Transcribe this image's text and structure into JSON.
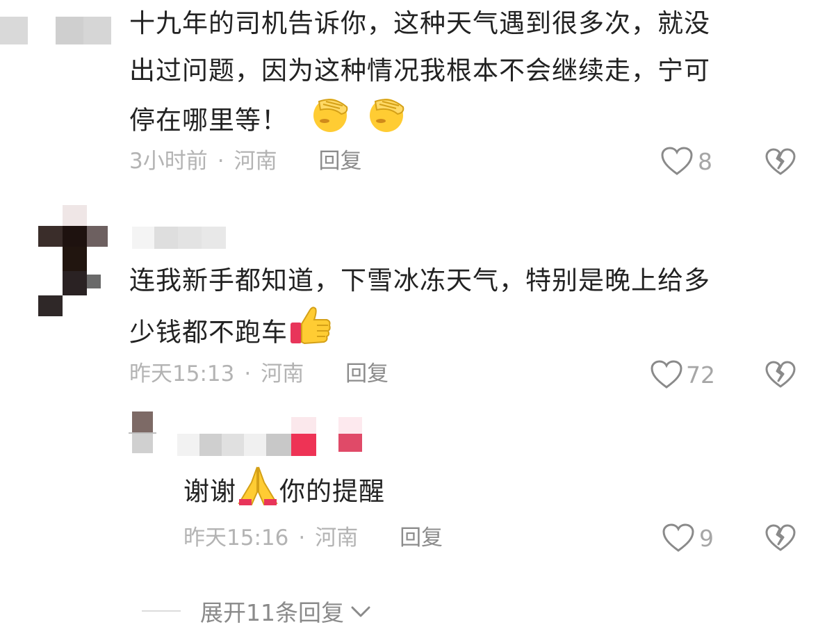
{
  "comments": [
    {
      "text_line1": "十九年的司机告诉你，这种天气遇到很多次，就没",
      "text_line2": "出过问题，因为这种情况我根本不会继续走，宁可",
      "text_line3": "停在哪里等！",
      "emoji": [
        "facepalm-emoji",
        "facepalm-emoji"
      ],
      "time": "3小时前",
      "location": "河南",
      "reply_label": "回复",
      "likes": "8"
    },
    {
      "text_line1": "连我新手都知道，下雪冰冻天气，特别是晚上给多",
      "text_line2": "少钱都不跑车",
      "emoji": [
        "thumbs-up-emoji"
      ],
      "time": "昨天15:13",
      "location": "河南",
      "reply_label": "回复",
      "likes": "72"
    }
  ],
  "reply": {
    "text_before": "谢谢",
    "text_after": "你的提醒",
    "emoji": [
      "folded-hands-emoji"
    ],
    "time": "昨天15:16",
    "location": "河南",
    "reply_label": "回复",
    "likes": "9"
  },
  "meta_separator": "·",
  "expand_label": "展开11条回复",
  "icons": {
    "like": "heart-outline-icon",
    "dislike": "broken-heart-icon",
    "expand": "chevron-down-icon"
  },
  "colors": {
    "text": "#222222",
    "meta": "#b3b3b3",
    "reply_link": "#8c8c8c",
    "accent_pink": "#e8355a"
  }
}
